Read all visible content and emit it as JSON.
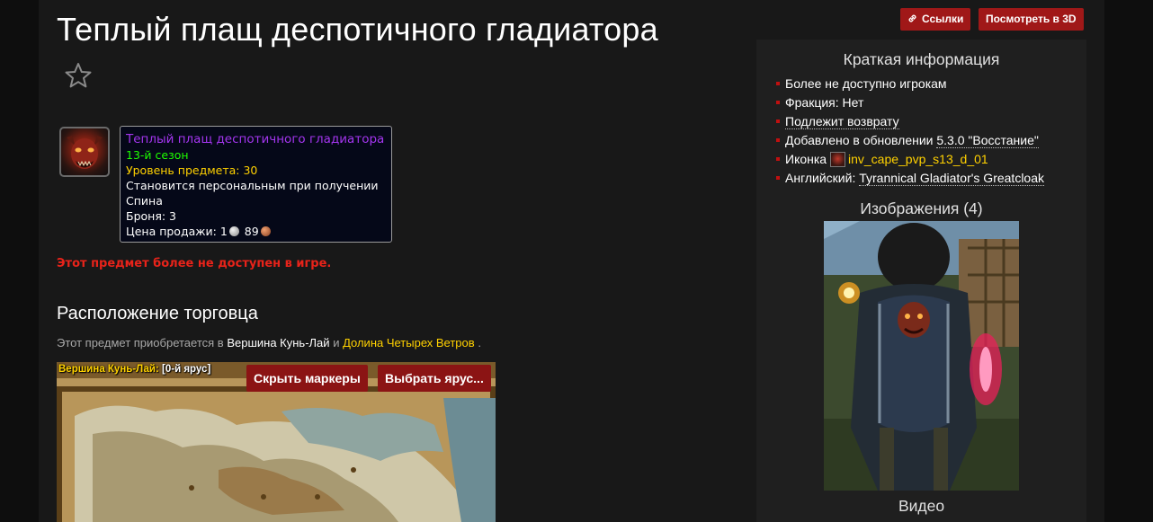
{
  "header": {
    "title": "Теплый плащ деспотичного гладиатора",
    "links_label": "Ссылки",
    "view3d_label": "Посмотреть в 3D"
  },
  "tooltip": {
    "name": "Теплый плащ деспотичного гладиатора",
    "season": "13-й сезон",
    "item_level": "Уровень предмета: 30",
    "binding": "Становится персональным при получении",
    "slot": "Спина",
    "armor": "Броня: 3",
    "sell_label": "Цена продажи:",
    "sell_silver": "1",
    "sell_copper": "89"
  },
  "notice": "Этот предмет более не доступен в игре.",
  "vendor": {
    "section_title": "Расположение торговца",
    "text_before": "Этот предмет приобретается в",
    "zone1": "Вершина Кунь-Лай",
    "conj": "и",
    "zone2": "Долина Четырех Ветров",
    "period": ".",
    "map_zone": "Вершина Кунь-Лай:",
    "map_floor": "[0-й ярус]",
    "hide_markers_label": "Скрыть маркеры",
    "select_floor_label": "Выбрать ярус..."
  },
  "sidebar": {
    "title": "Краткая информация",
    "items": [
      "Более не доступно игрокам",
      "Фракция: Нет",
      "Подлежит возврату",
      "Добавлено в обновлении",
      "Иконка",
      "Английский:"
    ],
    "patch": "5.3.0 \"Восстание\"",
    "icon_name": "inv_cape_pvp_s13_d_01",
    "english_name": "Tyrannical Gladiator's Greatcloak",
    "images_title": "Изображения (4)",
    "video_title": "Видео"
  },
  "colors": {
    "accent_red": "#a01818",
    "epic_purple": "#a335ee",
    "uncommon_green": "#1eff00",
    "gold": "#ffd100",
    "error_red": "#e8231a"
  },
  "icons": [
    "star-icon",
    "link-icon",
    "silver-coin-icon",
    "copper-coin-icon",
    "item-icon"
  ]
}
